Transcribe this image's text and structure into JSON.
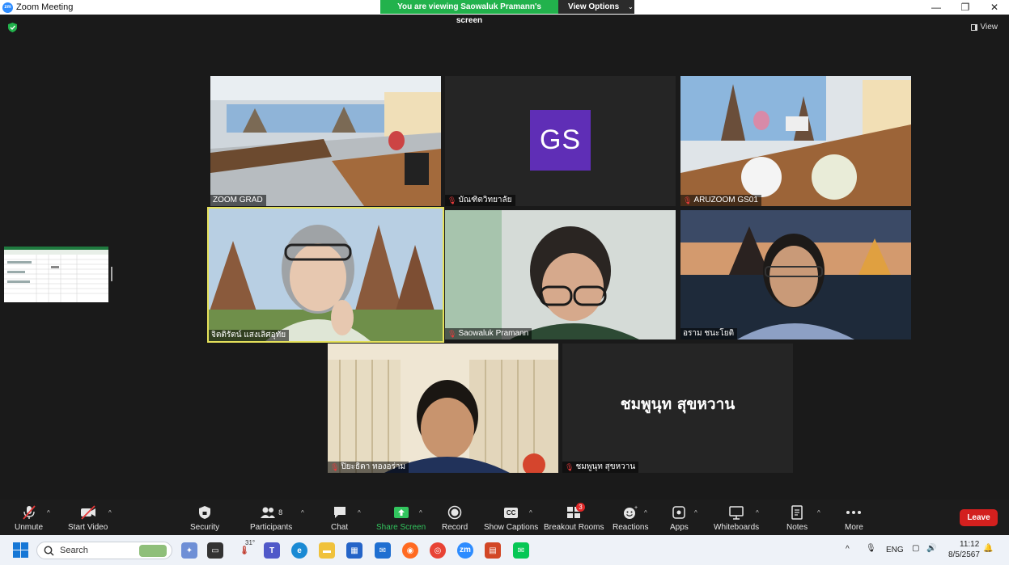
{
  "window": {
    "title": "Zoom Meeting",
    "logo_text": "zm",
    "minimize": "—",
    "restore": "❐",
    "close": "✕"
  },
  "share_banner": {
    "text": "You are viewing Saowaluk Pramann's screen",
    "options_label": "View Options"
  },
  "view_label": "View",
  "participants_tiles": [
    {
      "name": "ZOOM GRAD",
      "muted": false
    },
    {
      "name": "บัณฑิตวิทยาลัย",
      "muted": true,
      "avatar": "GS"
    },
    {
      "name": "ARUZOOM GS01",
      "muted": true
    },
    {
      "name": "จิตติรัตน์ แสงเลิศอุทัย",
      "muted": false
    },
    {
      "name": "Saowaluk Pramann",
      "muted": true
    },
    {
      "name": "อราม ชนะโยติ",
      "muted": false
    },
    {
      "name": "ปิยะธิดา ทองอร่าม",
      "muted": true
    },
    {
      "name": "ชมพูนุท สุขหวาน",
      "muted": true,
      "display_name": "ชมพูนุท  สุขหวาน"
    }
  ],
  "toolbar": {
    "unmute": "Unmute",
    "start_video": "Start Video",
    "security": "Security",
    "participants": "Participants",
    "participants_count": "8",
    "chat": "Chat",
    "share_screen": "Share Screen",
    "record": "Record",
    "show_captions": "Show Captions",
    "cc": "CC",
    "breakout_rooms": "Breakout Rooms",
    "breakout_badge": "3",
    "reactions": "Reactions",
    "apps": "Apps",
    "whiteboards": "Whiteboards",
    "notes": "Notes",
    "more": "More",
    "leave": "Leave"
  },
  "taskbar": {
    "search_placeholder": "Search",
    "lang": "ENG",
    "time": "11:12",
    "date": "8/5/2567",
    "weather_temp": "31°"
  },
  "colors": {
    "banner_green": "#22b24c",
    "avatar_purple": "#5f2eb6",
    "leave_red": "#d3201e",
    "active_speaker": "#e5e15b"
  }
}
